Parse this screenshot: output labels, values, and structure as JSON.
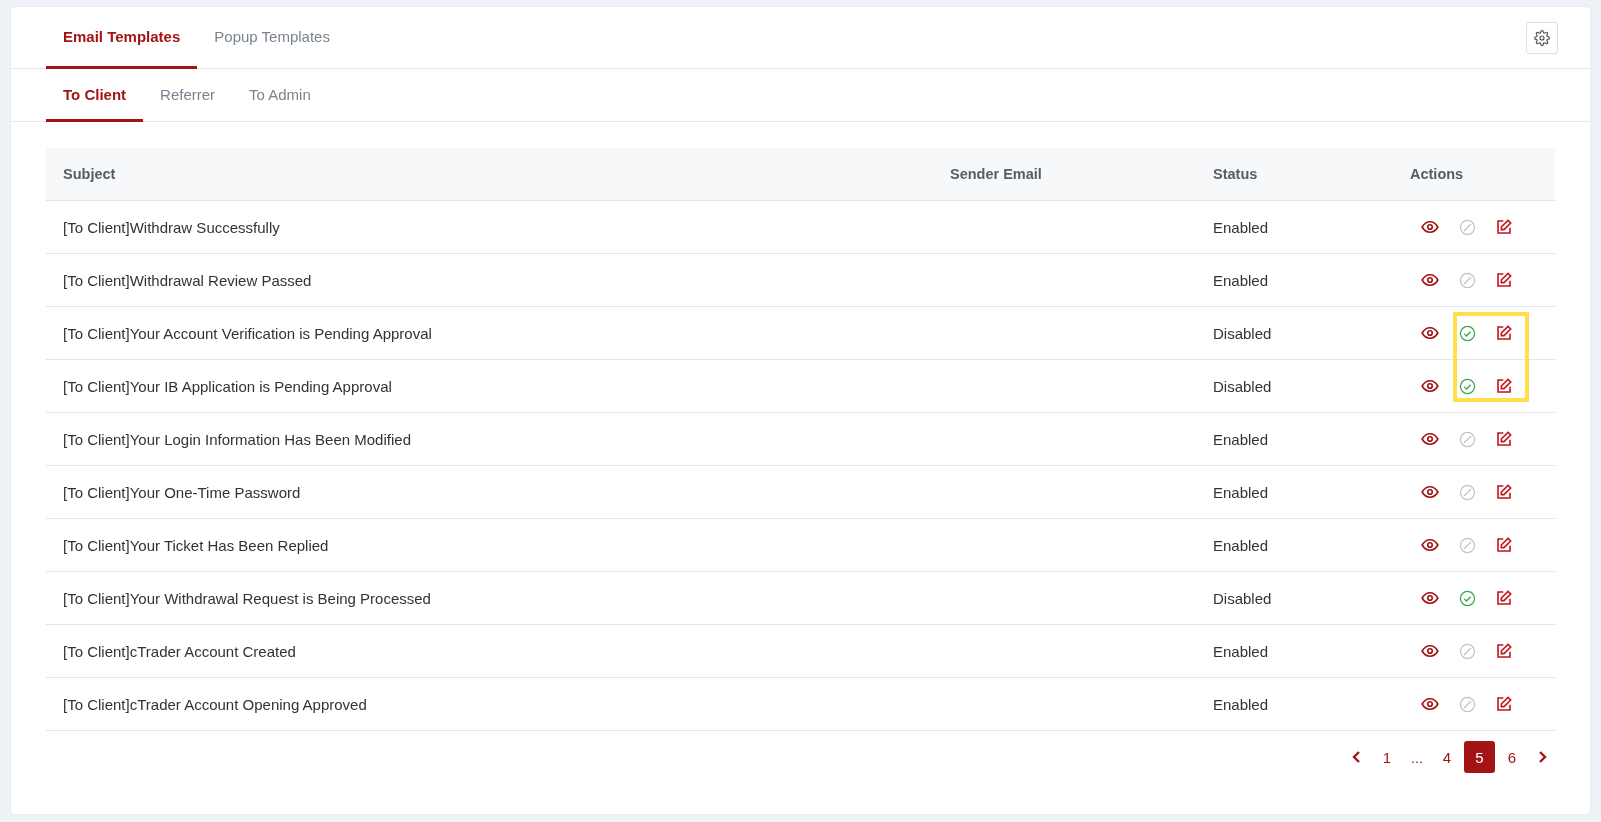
{
  "tabs": [
    {
      "label": "Email Templates",
      "selected": true
    },
    {
      "label": "Popup Templates",
      "selected": false
    }
  ],
  "sub_tabs": [
    {
      "label": "To Client",
      "selected": true
    },
    {
      "label": "Referrer",
      "selected": false
    },
    {
      "label": "To Admin",
      "selected": false
    }
  ],
  "table": {
    "columns": [
      "Subject",
      "Sender Email",
      "Status",
      "Actions"
    ],
    "rows": [
      {
        "subject": "[To Client]Withdraw Successfully",
        "status": "Enabled",
        "enabled": true,
        "highlighted": false
      },
      {
        "subject": "[To Client]Withdrawal Review Passed",
        "status": "Enabled",
        "enabled": true,
        "highlighted": false
      },
      {
        "subject": "[To Client]Your Account Verification is Pending Approval",
        "status": "Disabled",
        "enabled": false,
        "highlighted": true
      },
      {
        "subject": "[To Client]Your IB Application is Pending Approval",
        "status": "Disabled",
        "enabled": false,
        "highlighted": true
      },
      {
        "subject": "[To Client]Your Login Information Has Been Modified",
        "status": "Enabled",
        "enabled": true,
        "highlighted": false
      },
      {
        "subject": "[To Client]Your One-Time Password",
        "status": "Enabled",
        "enabled": true,
        "highlighted": false
      },
      {
        "subject": "[To Client]Your Ticket Has Been Replied",
        "status": "Enabled",
        "enabled": true,
        "highlighted": false
      },
      {
        "subject": "[To Client]Your Withdrawal Request is Being Processed",
        "status": "Disabled",
        "enabled": false,
        "highlighted": false
      },
      {
        "subject": "[To Client]cTrader Account Created",
        "status": "Enabled",
        "enabled": true,
        "highlighted": false
      },
      {
        "subject": "[To Client]cTrader Account Opening Approved",
        "status": "Enabled",
        "enabled": true,
        "highlighted": false
      }
    ]
  },
  "pagination": {
    "pages": [
      {
        "label": "1",
        "selected": false
      },
      {
        "label": "...",
        "selected": false
      },
      {
        "label": "4",
        "selected": false
      },
      {
        "label": "5",
        "selected": true
      },
      {
        "label": "6",
        "selected": false
      }
    ]
  }
}
